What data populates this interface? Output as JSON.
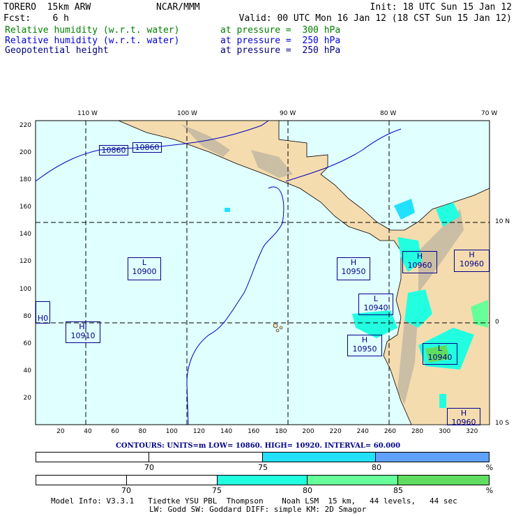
{
  "header": {
    "model": "TORERO  15km ARW",
    "org": "NCAR/MMM",
    "init": "Init: 18 UTC Sun 15 Jan 12",
    "fcst": "Fcst:    6 h",
    "valid": "Valid: 00 UTC Mon 16 Jan 12 (18 CST Sun 15 Jan 12)",
    "fields": [
      {
        "name": "Relative humidity (w.r.t. water)",
        "level": "at pressure =  300 hPa",
        "color": "#008000"
      },
      {
        "name": "Relative humidity (w.r.t. water)",
        "level": "at pressure =  250 hPa",
        "color": "#0000e0"
      },
      {
        "name": "Geopotential height",
        "level": "at pressure =  250 hPa",
        "color": "#000080"
      }
    ]
  },
  "map": {
    "lon_labels": [
      "110 W",
      "100 W",
      "90 W",
      "80 W",
      "70 W"
    ],
    "lat_labels": [
      "10 N",
      "0",
      "10 S"
    ],
    "y_ticks": [
      "220",
      "200",
      "180",
      "160",
      "140",
      "120",
      "100",
      "80",
      "60",
      "40",
      "20"
    ],
    "x_ticks": [
      "20",
      "40",
      "60",
      "80",
      "100",
      "120",
      "140",
      "160",
      "180",
      "200",
      "220",
      "240",
      "260",
      "280",
      "300",
      "320"
    ],
    "contour_labels": [
      "10860",
      "10860"
    ],
    "centers": [
      {
        "type": "L",
        "value": "10900"
      },
      {
        "type": "H",
        "value": "10950"
      },
      {
        "type": "H",
        "value": "10960"
      },
      {
        "type": "H",
        "value": "10960"
      },
      {
        "type": "L",
        "value": "10940"
      },
      {
        "type": "H",
        "value": "10950"
      },
      {
        "type": "L",
        "value": "10940"
      },
      {
        "type": "HI",
        "value": "10910"
      },
      {
        "type": "",
        "value": "H0"
      },
      {
        "type": "H",
        "value": "10960"
      }
    ]
  },
  "contours_line": "CONTOURS:  UNITS=m  LOW=  10860.      HIGH=  10920.      INTERVAL=   60.000",
  "colorbar1": {
    "labels": [
      "70",
      "75",
      "80",
      "%"
    ],
    "colors": [
      "#ffffff",
      "#ffffff",
      "#22e0ff",
      "#60a0ff"
    ]
  },
  "colorbar2": {
    "labels": [
      "70",
      "75",
      "80",
      "85",
      "%"
    ],
    "colors": [
      "#ffffff",
      "#ffffff",
      "#22ffe0",
      "#66ff99",
      "#60dd60"
    ]
  },
  "footer": {
    "line1": "Model Info: V3.3.1   Tiedtke YSU PBL  Thompson    Noah LSM  15 km,   44 levels,   44 sec",
    "line2": "LW: Godd SW: Goddard DIFF: simple KM: 2D Smagor"
  }
}
